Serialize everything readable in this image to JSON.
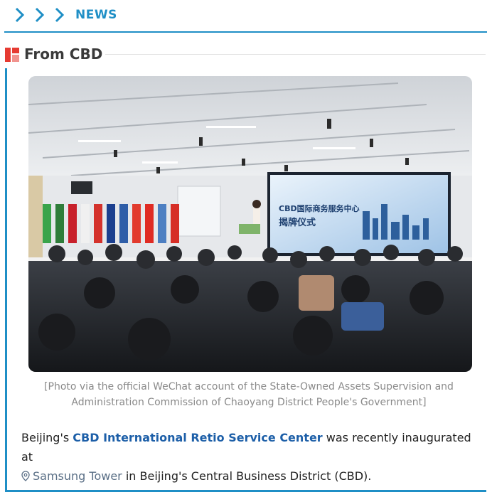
{
  "header": {
    "label": "NEWS",
    "accent": "#1f8fc6"
  },
  "section": {
    "title": "From CBD",
    "icon_color": "#e63b32"
  },
  "photo": {
    "screen_title": "CBD国际商务服务中心",
    "screen_subtitle": "揭牌仪式"
  },
  "caption": {
    "line1": "[Photo via the official WeChat account of the State-Owned Assets Supervision and",
    "line2": "Administration Commission of Chaoyang District People's Government]"
  },
  "article": {
    "p1_start": "Beijing's ",
    "link_text": "CBD International Retio Service Center",
    "p1_mid": " was recently inaugurated at",
    "location_text": "Samsung Tower",
    "p1_end": " in Beijing's Central Business District (CBD)."
  },
  "icons": {
    "chevron": "chevron-right-icon",
    "section": "red-squares-icon",
    "location": "location-pin-icon"
  }
}
